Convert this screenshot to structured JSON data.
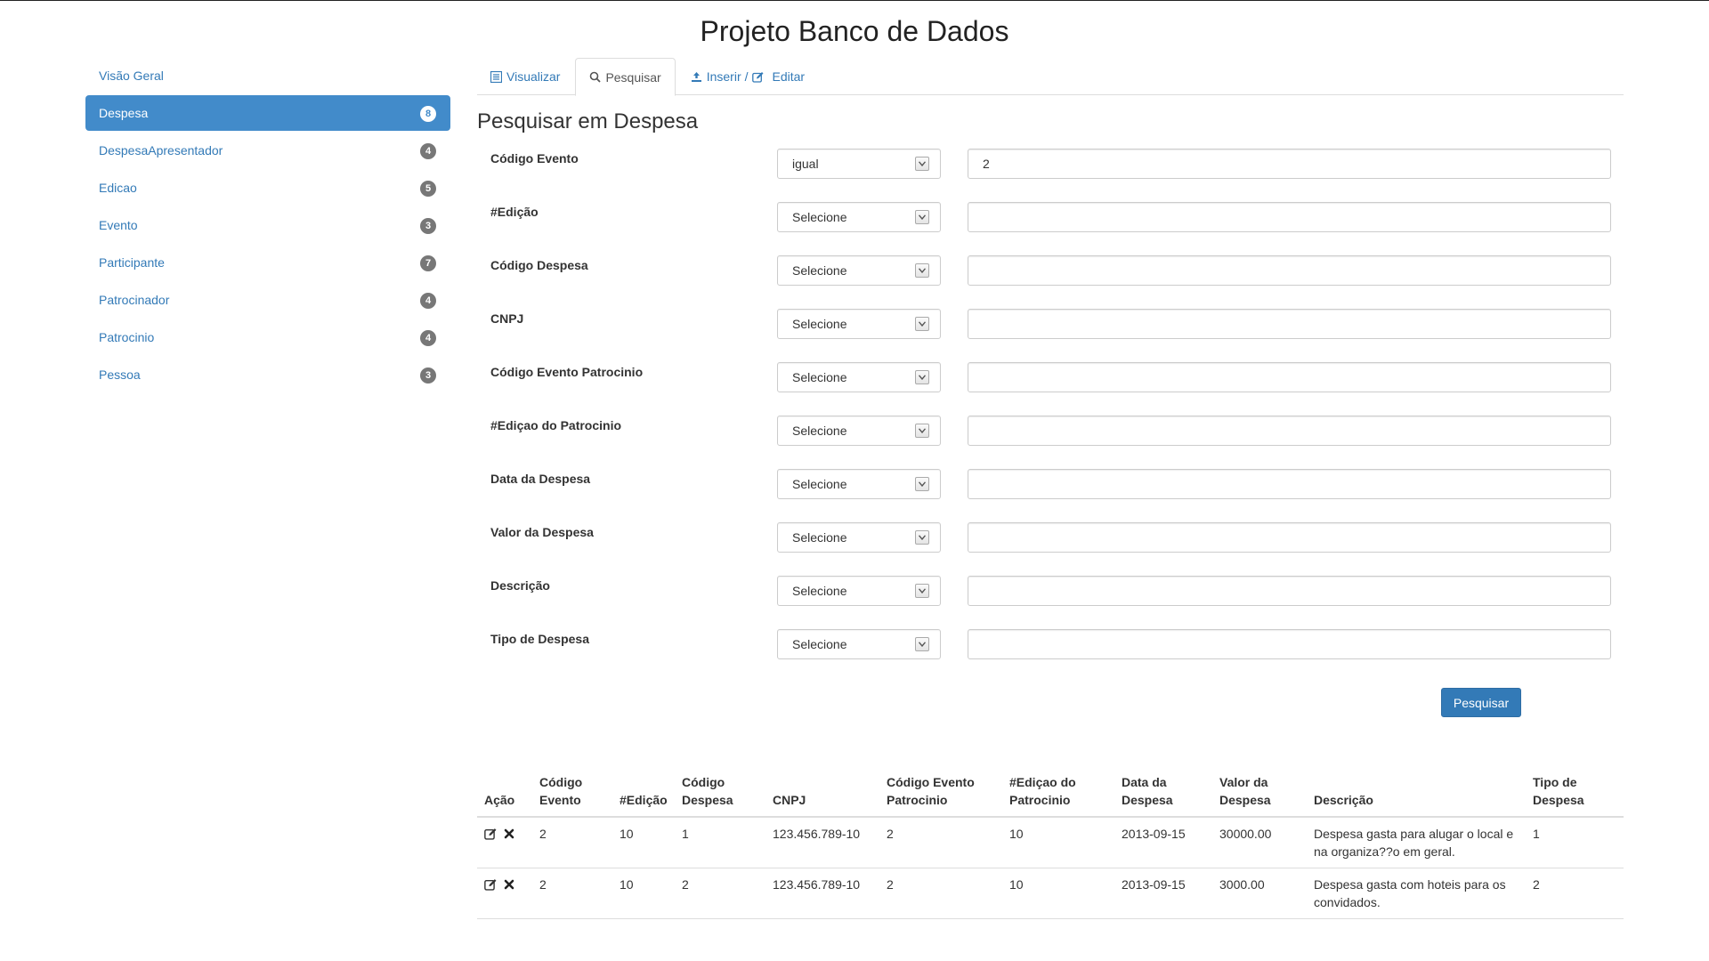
{
  "app": {
    "title": "Projeto Banco de Dados"
  },
  "sidebar": {
    "items": [
      {
        "label": "Visão Geral",
        "badge": ""
      },
      {
        "label": "Despesa",
        "badge": "8",
        "active": true
      },
      {
        "label": "DespesaApresentador",
        "badge": "4"
      },
      {
        "label": "Edicao",
        "badge": "5"
      },
      {
        "label": "Evento",
        "badge": "3"
      },
      {
        "label": "Participante",
        "badge": "7"
      },
      {
        "label": "Patrocinador",
        "badge": "4"
      },
      {
        "label": "Patrocinio",
        "badge": "4"
      },
      {
        "label": "Pessoa",
        "badge": "3"
      }
    ]
  },
  "tabs": {
    "visualizar": "Visualizar",
    "pesquisar": "Pesquisar",
    "inserir": "Inserir",
    "separator": "/",
    "editar": "Editar"
  },
  "search": {
    "title": "Pesquisar em Despesa",
    "fields": [
      {
        "label": "Código Evento",
        "operator": "igual",
        "value": "2"
      },
      {
        "label": "#Edição",
        "operator": "Selecione",
        "value": ""
      },
      {
        "label": "Código Despesa",
        "operator": "Selecione",
        "value": ""
      },
      {
        "label": "CNPJ",
        "operator": "Selecione",
        "value": ""
      },
      {
        "label": "Código Evento Patrocinio",
        "operator": "Selecione",
        "value": ""
      },
      {
        "label": "#Ediçao do Patrocinio",
        "operator": "Selecione",
        "value": ""
      },
      {
        "label": "Data da Despesa",
        "operator": "Selecione",
        "value": ""
      },
      {
        "label": "Valor da Despesa",
        "operator": "Selecione",
        "value": ""
      },
      {
        "label": "Descrição",
        "operator": "Selecione",
        "value": ""
      },
      {
        "label": "Tipo de Despesa",
        "operator": "Selecione",
        "value": ""
      }
    ],
    "submit_label": "Pesquisar"
  },
  "results": {
    "headers": [
      "Ação",
      "Código Evento",
      "#Edição",
      "Código Despesa",
      "CNPJ",
      "Código Evento Patrocinio",
      "#Ediçao do Patrocinio",
      "Data da Despesa",
      "Valor da Despesa",
      "Descrição",
      "Tipo de Despesa"
    ],
    "rows": [
      [
        "",
        "2",
        "10",
        "1",
        "123.456.789-10",
        "2",
        "10",
        "2013-09-15",
        "30000.00",
        "Despesa gasta para alugar o local e na organiza??o em geral.",
        "1"
      ],
      [
        "",
        "2",
        "10",
        "2",
        "123.456.789-10",
        "2",
        "10",
        "2013-09-15",
        "3000.00",
        "Despesa gasta com hoteis para os convidados.",
        "2"
      ]
    ]
  },
  "icons": {
    "visualizar_tab": "list-icon",
    "pesquisar_tab": "search-icon",
    "inserir_tab": "upload-icon",
    "editar_tab": "edit-icon",
    "row_edit": "edit-icon",
    "row_delete": "close-icon"
  },
  "colors": {
    "accent": "#428bca",
    "link": "#337ab7",
    "badge": "#777777"
  }
}
